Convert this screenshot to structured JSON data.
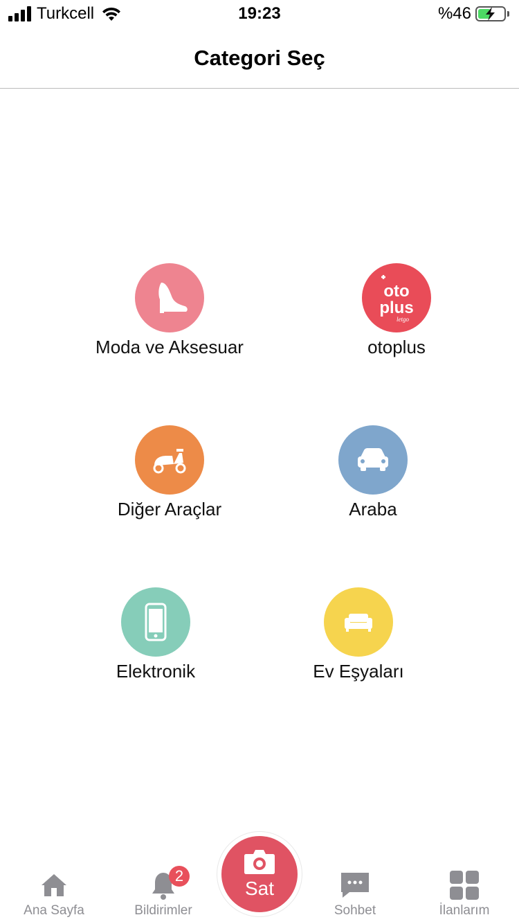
{
  "status_bar": {
    "carrier": "Turkcell",
    "time": "19:23",
    "battery_percent": "%46"
  },
  "header": {
    "title": "Categori Seç"
  },
  "categories": [
    {
      "label": "Moda ve Aksesuar",
      "icon": "high-heel-icon",
      "color": "#ee8490"
    },
    {
      "label": "otoplus",
      "icon": "otoplus-logo",
      "color": "#e94c58",
      "logo_text": [
        "oto",
        "plus",
        "letgo"
      ]
    },
    {
      "label": "Diğer Araçlar",
      "icon": "scooter-icon",
      "color": "#ed8b48"
    },
    {
      "label": "Araba",
      "icon": "car-icon",
      "color": "#7fa6cc"
    },
    {
      "label": "Elektronik",
      "icon": "phone-icon",
      "color": "#86cdb9"
    },
    {
      "label": "Ev Eşyaları",
      "icon": "sofa-icon",
      "color": "#f6d44e"
    }
  ],
  "tabbar": {
    "home": {
      "label": "Ana Sayfa",
      "icon": "home-icon"
    },
    "notifications": {
      "label": "Bildirimler",
      "icon": "bell-icon",
      "badge": "2"
    },
    "sell": {
      "label": "Sat",
      "icon": "camera-icon",
      "color": "#e05363"
    },
    "chat": {
      "label": "Sohbet",
      "icon": "chat-bubble-icon"
    },
    "listings": {
      "label": "İlanlarım",
      "icon": "grid-icon"
    }
  }
}
